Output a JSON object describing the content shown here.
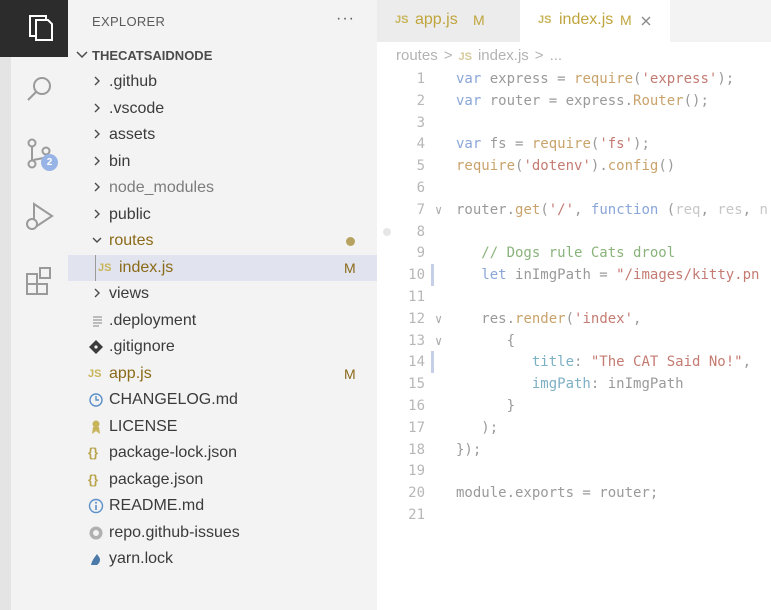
{
  "activity": {
    "badge_count": "2",
    "icons": [
      "explorer-icon",
      "search-icon",
      "source-control-icon",
      "run-debug-icon",
      "extensions-icon"
    ]
  },
  "sidebar": {
    "title": "EXPLORER",
    "more": "···",
    "folder_name": "THECATSAIDNODE",
    "items": [
      {
        "label": ".github",
        "kind": "folder"
      },
      {
        "label": ".vscode",
        "kind": "folder"
      },
      {
        "label": "assets",
        "kind": "folder"
      },
      {
        "label": "bin",
        "kind": "folder"
      },
      {
        "label": "node_modules",
        "kind": "folder"
      },
      {
        "label": "public",
        "kind": "folder"
      },
      {
        "label": "routes",
        "kind": "folder-open"
      },
      {
        "label": "index.js",
        "kind": "js",
        "flag": "M"
      },
      {
        "label": "views",
        "kind": "folder"
      },
      {
        "label": ".deployment",
        "kind": "file"
      },
      {
        "label": ".gitignore",
        "kind": "git"
      },
      {
        "label": "app.js",
        "kind": "js",
        "flag": "M"
      },
      {
        "label": "CHANGELOG.md",
        "kind": "changelog"
      },
      {
        "label": "LICENSE",
        "kind": "license"
      },
      {
        "label": "package-lock.json",
        "kind": "json"
      },
      {
        "label": "package.json",
        "kind": "json"
      },
      {
        "label": "README.md",
        "kind": "readme"
      },
      {
        "label": "repo.github-issues",
        "kind": "github"
      },
      {
        "label": "yarn.lock",
        "kind": "yarn"
      }
    ]
  },
  "tabs": [
    {
      "label": "app.js",
      "flag": "M",
      "active": false
    },
    {
      "label": "index.js",
      "flag": "M",
      "active": true
    }
  ],
  "breadcrumb": [
    "routes",
    ">",
    "JS",
    "index.js",
    ">",
    "..."
  ],
  "editor": {
    "lines": [
      "var express = require('express');",
      "var router = express.Router();",
      "",
      "var fs = require('fs');",
      "require('dotenv').config()",
      "",
      "router.get('/', function (req, res, n",
      "",
      "   // Dogs rule Cats drool",
      "   let inImgPath = \"/images/kitty.pn",
      "",
      "   res.render('index',",
      "      {",
      "         title: \"The CAT Said No!\",",
      "         imgPath: inImgPath",
      "      }",
      "   );",
      "});",
      "",
      "module.exports = router;",
      ""
    ]
  }
}
